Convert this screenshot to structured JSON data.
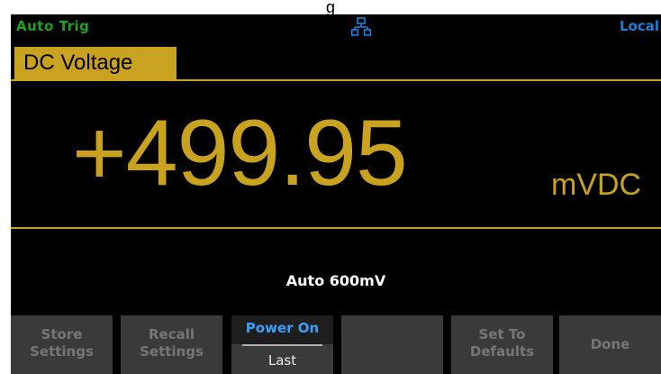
{
  "caption": "g",
  "status": {
    "trigger": "Auto Trig",
    "network_icon": "network-icon",
    "mode": "Local"
  },
  "function": {
    "label": "DC Voltage"
  },
  "measurement": {
    "value": "+499.95",
    "unit": "mVDC"
  },
  "range": {
    "label": "Auto 600mV"
  },
  "softkeys": [
    {
      "line1": "Store",
      "line2": "Settings"
    },
    {
      "line1": "Recall",
      "line2": "Settings"
    },
    {
      "title": "Power On",
      "value": "Last"
    },
    {
      "line1": "",
      "line2": ""
    },
    {
      "line1": "Set To",
      "line2": "Defaults"
    },
    {
      "label": "Done"
    }
  ],
  "colors": {
    "accent": "#c9a21f",
    "trigger": "#1fa31f",
    "local": "#1e7fd8",
    "power_on": "#3aa0ff"
  }
}
